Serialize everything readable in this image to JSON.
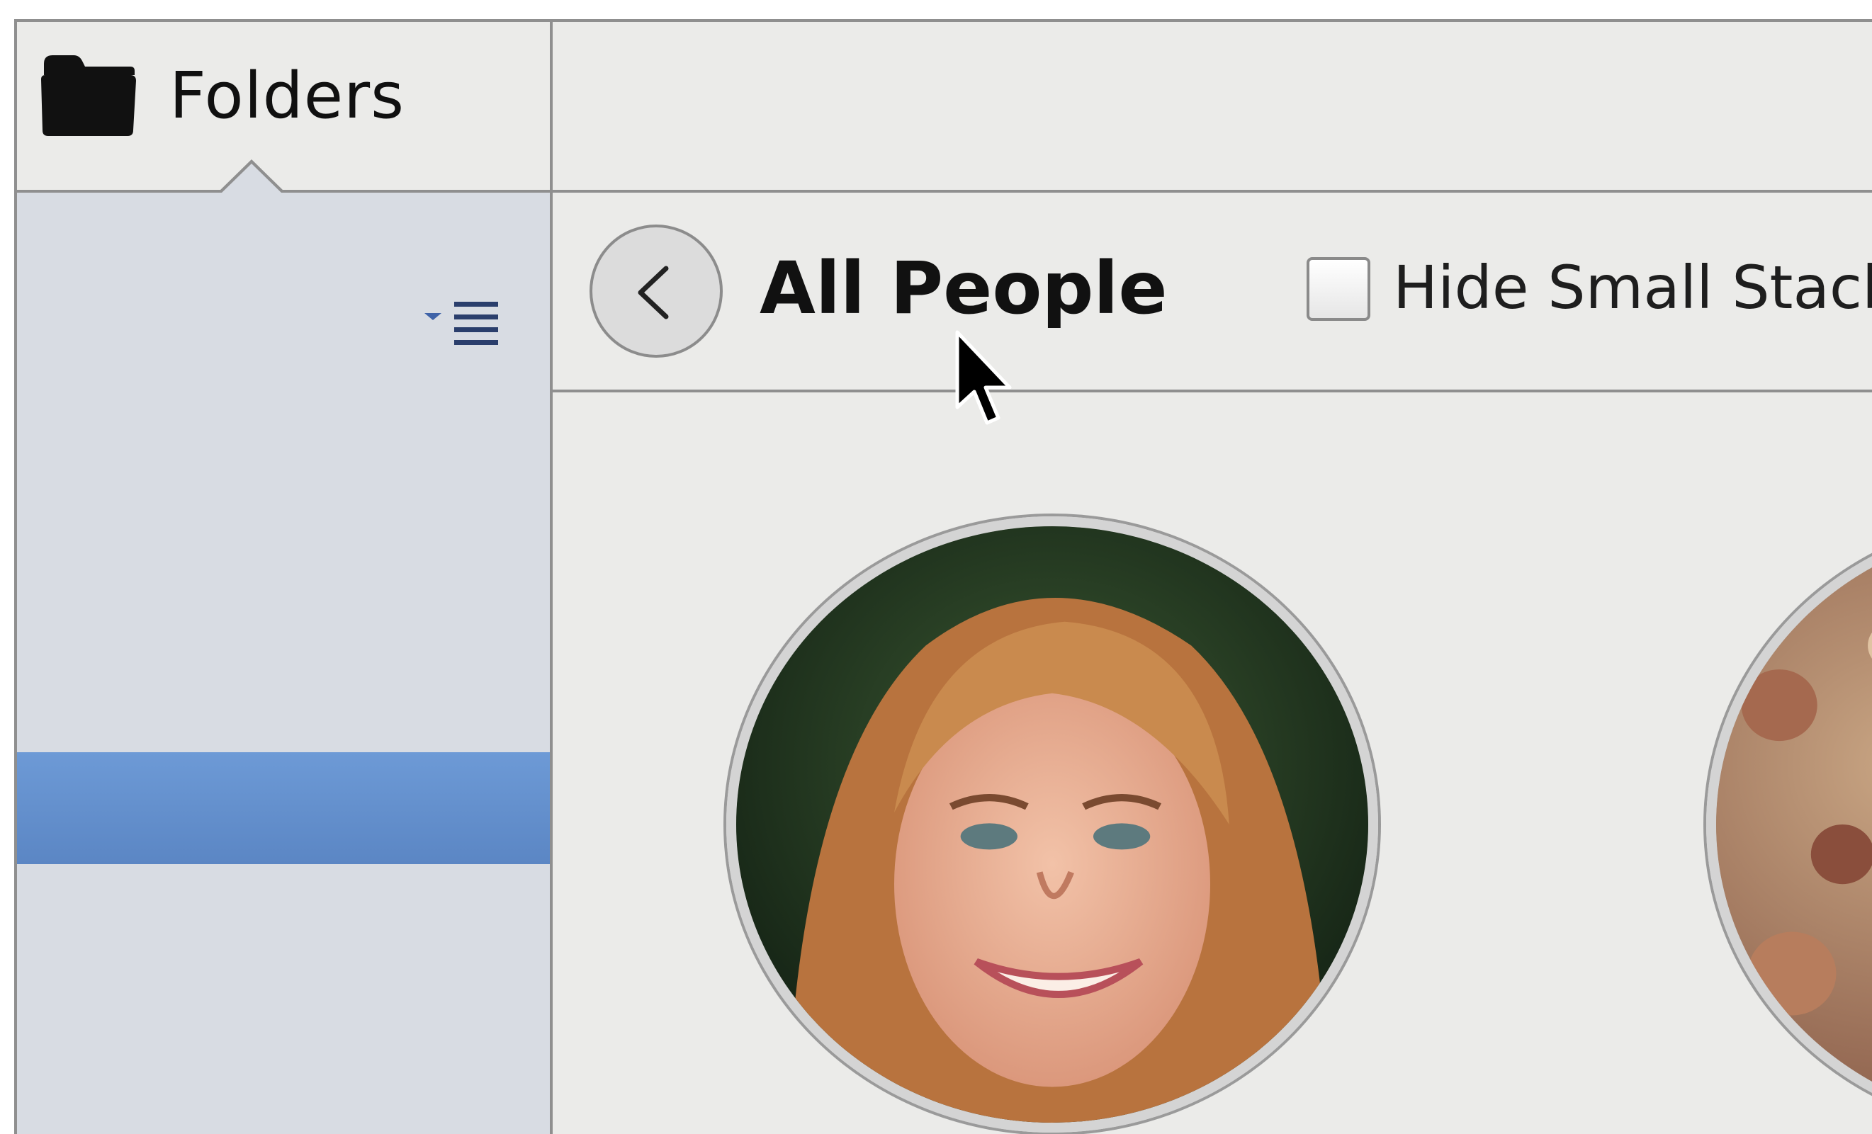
{
  "sidebar": {
    "header_label": "Folders",
    "header_icon": "folder-icon",
    "sort_icon": "sort-list-icon"
  },
  "nav": {
    "back_icon": "chevron-left-icon",
    "title": "All People",
    "hide_small_stacks_label": "Hide Small Stack",
    "hide_small_stacks_checked": false
  },
  "people": [
    {
      "name": "",
      "icon": "person-photo"
    },
    {
      "name": "",
      "icon": "person-photo"
    }
  ],
  "colors": {
    "selection": "#6d9ad6",
    "sidebar_bg": "#d8dce3",
    "window_bg": "#ebebe9",
    "divider": "#8f8f8f"
  }
}
